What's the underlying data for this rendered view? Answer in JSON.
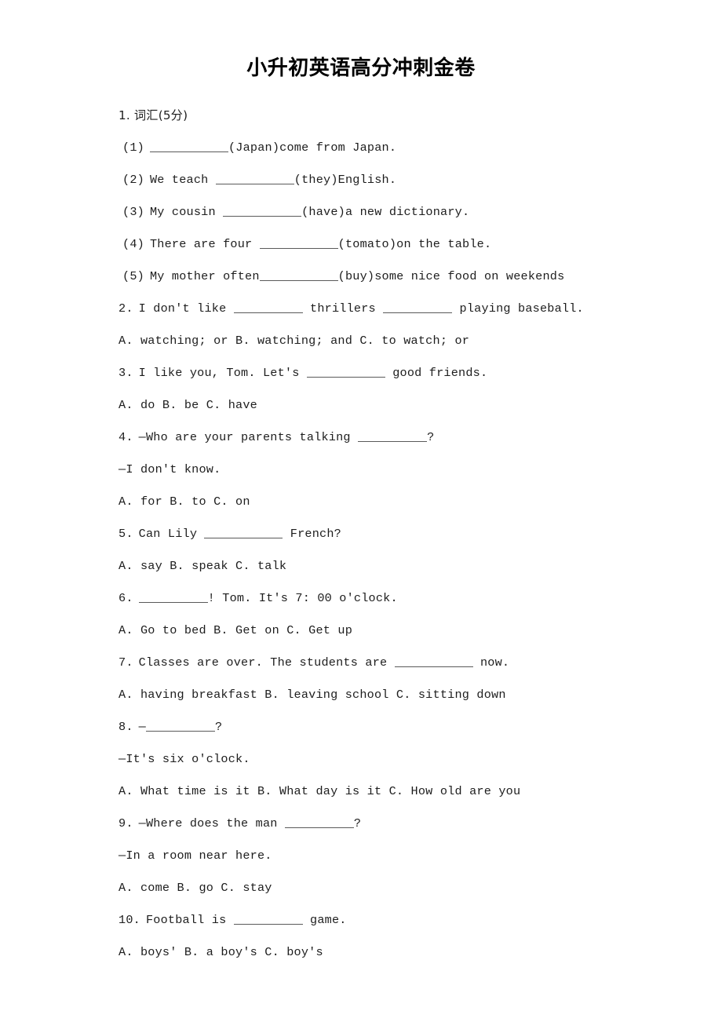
{
  "document": {
    "title": "小升初英语高分冲刺金卷",
    "background_color": "#ffffff",
    "text_color": "#1d1d1d"
  },
  "section_1": {
    "heading": "1. 词汇(5分)",
    "items": [
      {
        "label": "(1)",
        "before": "",
        "after": "(Japan)come from Japan."
      },
      {
        "label": "(2)",
        "before": "We teach ",
        "after": "(they)English."
      },
      {
        "label": "(3)",
        "before": "My cousin ",
        "after": "(have)a new dictionary."
      },
      {
        "label": "(4)",
        "before": "There are four ",
        "after": "(tomato)on the table."
      },
      {
        "label": "(5)",
        "before": "My mother often",
        "after": "(buy)some nice food on weekends"
      }
    ]
  },
  "questions": [
    {
      "number": "2.",
      "stem_before": "I don't like ",
      "stem_middle": " thrillers ",
      "stem_after": " playing baseball.",
      "options": "A. watching; or   B. watching; and   C. to watch; or"
    },
    {
      "number": "3.",
      "stem_before": "I like you, Tom. Let's ",
      "stem_after": " good friends.",
      "options": "A. do   B. be   C. have"
    },
    {
      "number": "4.",
      "stem_before": "—Who are your parents talking ",
      "stem_after": "?",
      "reply": "—I don't know.",
      "options": "A. for   B. to   C. on"
    },
    {
      "number": "5.",
      "stem_before": "Can Lily ",
      "stem_after": " French?",
      "options": "A. say   B. speak   C. talk"
    },
    {
      "number": "6.",
      "stem_before": "",
      "stem_after": "! Tom. It's 7: 00 o'clock.",
      "options": "A. Go to bed   B. Get on   C. Get up"
    },
    {
      "number": "7.",
      "stem_before": "Classes are over. The students are ",
      "stem_after": " now.",
      "options": "A. having breakfast    B. leaving school    C. sitting down"
    },
    {
      "number": "8.",
      "stem_before": "—",
      "stem_after": "?",
      "reply": "—It's six o'clock.",
      "options": "A. What time is it   B. What day is it    C. How old are you"
    },
    {
      "number": "9.",
      "stem_before": "—Where does the man ",
      "stem_after": "?",
      "reply": "—In a room near here.",
      "options": "A. come   B. go   C. stay"
    },
    {
      "number": "10.",
      "stem_before": "Football is ",
      "stem_after": " game.",
      "options": "A. boys'   B. a boy's  C. boy's"
    }
  ]
}
